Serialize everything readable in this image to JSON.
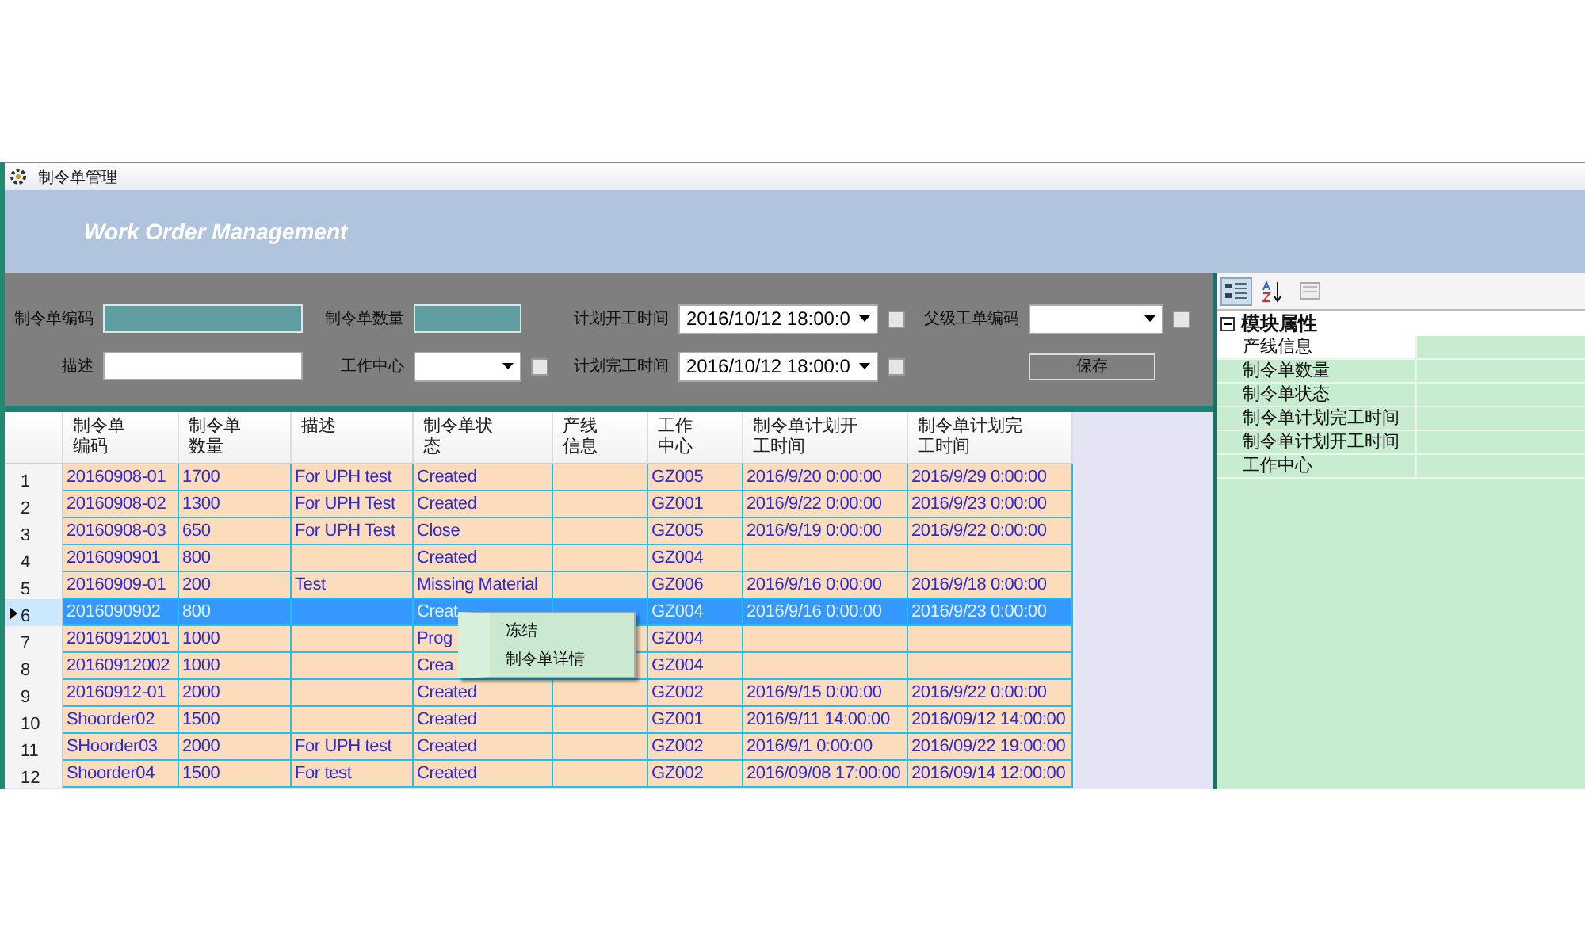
{
  "window": {
    "title": "制令单管理"
  },
  "header": {
    "title": "Work Order Management"
  },
  "form": {
    "rows": [
      [
        {
          "kind": "text",
          "label": "制令单编码",
          "required": true
        },
        {
          "kind": "text",
          "label": "制令单数量",
          "required": true
        },
        {
          "kind": "date",
          "label": "计划开工时间",
          "value": "2016/10/12 18:00:0",
          "checked": false
        },
        {
          "kind": "combo",
          "label": "父级工单编码",
          "checked": false
        }
      ],
      [
        {
          "kind": "text",
          "label": "描述",
          "required": false
        },
        {
          "kind": "combo",
          "label": "工作中心",
          "checked": false
        },
        {
          "kind": "date",
          "label": "计划完工时间",
          "value": "2016/10/12 18:00:0",
          "checked": false
        },
        {
          "kind": "button",
          "label": "保存"
        }
      ]
    ]
  },
  "table": {
    "columns": [
      "制令单编码",
      "制令单数量",
      "描述",
      "制令单状态",
      "产线信息",
      "工作中心",
      "制令单计划开工时间",
      "制令单计划完工时间"
    ],
    "rows": [
      {
        "num": "1",
        "selected": false,
        "cells": [
          "20160908-01",
          "1700",
          "For UPH test",
          "Created",
          "",
          "GZ005",
          "2016/9/20 0:00:00",
          "2016/9/29 0:00:00"
        ]
      },
      {
        "num": "2",
        "selected": false,
        "cells": [
          "20160908-02",
          "1300",
          "For UPH Test",
          "Created",
          "",
          "GZ001",
          "2016/9/22 0:00:00",
          "2016/9/23 0:00:00"
        ]
      },
      {
        "num": "3",
        "selected": false,
        "cells": [
          "20160908-03",
          "650",
          "For UPH Test",
          "Close",
          "",
          "GZ005",
          "2016/9/19 0:00:00",
          "2016/9/22 0:00:00"
        ]
      },
      {
        "num": "4",
        "selected": false,
        "cells": [
          "2016090901",
          "800",
          "",
          "Created",
          "",
          "GZ004",
          "",
          ""
        ]
      },
      {
        "num": "5",
        "selected": false,
        "cells": [
          "20160909-01",
          "200",
          "Test",
          "Missing Material",
          "",
          "GZ006",
          "2016/9/16 0:00:00",
          "2016/9/18 0:00:00"
        ]
      },
      {
        "num": "6",
        "selected": true,
        "cells": [
          "2016090902",
          "800",
          "",
          "Creat",
          "",
          "GZ004",
          "2016/9/16 0:00:00",
          "2016/9/23 0:00:00"
        ]
      },
      {
        "num": "7",
        "selected": false,
        "cells": [
          "20160912001",
          "1000",
          "",
          "Prog",
          "",
          "GZ004",
          "",
          ""
        ]
      },
      {
        "num": "8",
        "selected": false,
        "cells": [
          "20160912002",
          "1000",
          "",
          "Crea",
          "",
          "GZ004",
          "",
          ""
        ]
      },
      {
        "num": "9",
        "selected": false,
        "cells": [
          "20160912-01",
          "2000",
          "",
          "Created",
          "",
          "GZ002",
          "2016/9/15 0:00:00",
          "2016/9/22 0:00:00"
        ]
      },
      {
        "num": "10",
        "selected": false,
        "cells": [
          "Shoorder02",
          "1500",
          "",
          "Created",
          "",
          "GZ001",
          "2016/9/11 14:00:00",
          "2016/09/12 14:00:00"
        ]
      },
      {
        "num": "11",
        "selected": false,
        "cells": [
          "SHoorder03",
          "2000",
          "For UPH test",
          "Created",
          "",
          "GZ002",
          "2016/9/1 0:00:00",
          "2016/09/22 19:00:00"
        ]
      },
      {
        "num": "12",
        "selected": false,
        "cells": [
          "Shoorder04",
          "1500",
          "For test",
          "Created",
          "",
          "GZ002",
          "2016/09/08 17:00:00",
          "2016/09/14 12:00:00"
        ]
      }
    ]
  },
  "context_menu": {
    "items": [
      "冻结",
      "制令单详情"
    ]
  },
  "properties": {
    "category": "模块属性",
    "expanded": true,
    "items": [
      {
        "label": "产线信息",
        "selected": true
      },
      {
        "label": "制令单数量",
        "selected": false
      },
      {
        "label": "制令单状态",
        "selected": false
      },
      {
        "label": "制令单计划完工时间",
        "selected": false
      },
      {
        "label": "制令单计划开工时间",
        "selected": false
      },
      {
        "label": "工作中心",
        "selected": false
      }
    ]
  }
}
